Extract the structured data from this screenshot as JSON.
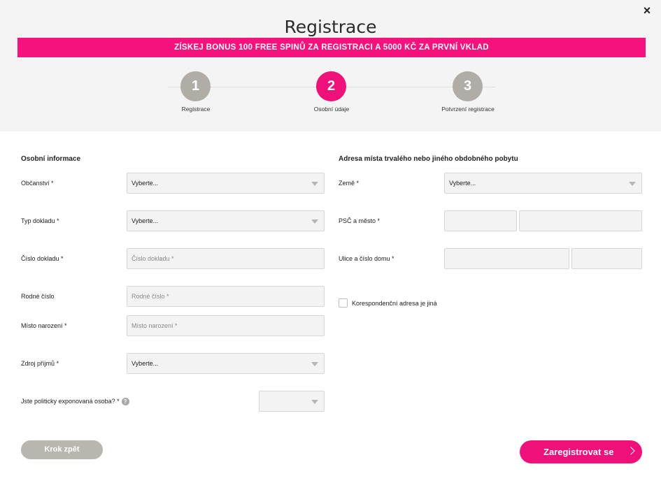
{
  "header": {
    "title": "Registrace",
    "close_icon": "×",
    "banner": "ZÍSKEJ BONUS 100 FREE SPINŮ ZA REGISTRACI A 5000 KČ ZA PRVNÍ VKLAD"
  },
  "steps": [
    {
      "number": "1",
      "label": "Registrace",
      "active": false
    },
    {
      "number": "2",
      "label": "Osobní údaje",
      "active": true
    },
    {
      "number": "3",
      "label": "Potvrzení registrace",
      "active": false
    }
  ],
  "personal": {
    "section_title": "Osobní informace",
    "citizenship": {
      "label": "Občanství *",
      "value": "Vyberte..."
    },
    "doc_type": {
      "label": "Typ dokladu *",
      "value": "Vyberte..."
    },
    "doc_number": {
      "label": "Číslo dokladu *",
      "placeholder": "Číslo dokladu *"
    },
    "birth_number": {
      "label": "Rodné číslo",
      "placeholder": "Rodné číslo *"
    },
    "birth_place": {
      "label": "Místo narození *",
      "placeholder": "Místo narození *"
    },
    "income_source": {
      "label": "Zdroj příjmů *",
      "value": "Vyberte..."
    },
    "pep": {
      "label": "Jste politicky exponovaná osoba? *",
      "help": "?",
      "value": ""
    }
  },
  "address": {
    "section_title": "Adresa místa trvalého nebo jiného obdobného pobytu",
    "country": {
      "label": "Země *",
      "value": "Vyberte..."
    },
    "zip_city": {
      "label": "PSČ a město *"
    },
    "street": {
      "label": "Ulice a číslo domu *"
    },
    "correspondence": {
      "label": "Korespondenční adresa je jiná",
      "checked": false
    }
  },
  "buttons": {
    "back": "Krok zpět",
    "submit": "Zaregistrovat se"
  },
  "colors": {
    "accent": "#f0107a",
    "step_inactive": "#b0ada6",
    "back_button": "#b9b6b0"
  }
}
